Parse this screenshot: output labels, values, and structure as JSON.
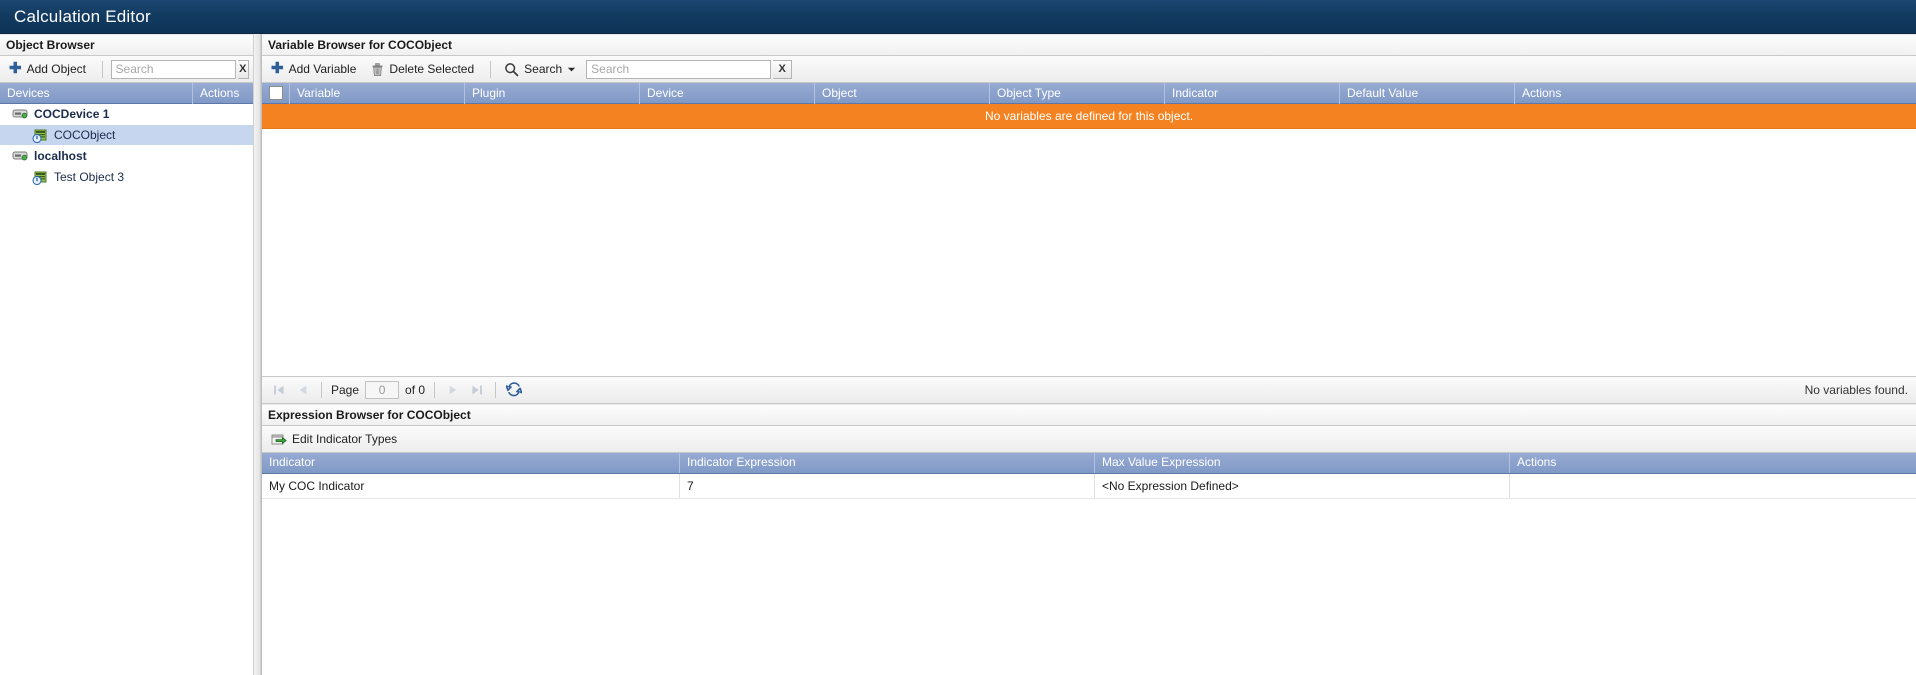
{
  "window": {
    "app_title": "Calculation Editor"
  },
  "object_browser": {
    "header": "Object Browser",
    "toolbar": {
      "add_object_label": "Add Object",
      "search_placeholder": "Search",
      "search_value": "",
      "clear_label": "X"
    },
    "columns": [
      "Devices",
      "Actions"
    ],
    "tree": [
      {
        "label": "COCDevice 1",
        "type": "device",
        "level": 1,
        "selected": false,
        "icon": "server-icon"
      },
      {
        "label": "COCObject",
        "type": "object",
        "level": 2,
        "selected": true,
        "icon": "chip-icon"
      },
      {
        "label": "localhost",
        "type": "device",
        "level": 1,
        "selected": false,
        "icon": "server-icon"
      },
      {
        "label": "Test Object 3",
        "type": "object",
        "level": 2,
        "selected": false,
        "icon": "chip-icon"
      }
    ]
  },
  "variable_browser": {
    "header": "Variable Browser for COCObject",
    "toolbar": {
      "add_variable_label": "Add Variable",
      "delete_selected_label": "Delete Selected",
      "search_menu_label": "Search",
      "search_placeholder": "Search",
      "search_value": "",
      "clear_label": "X"
    },
    "columns": [
      "Variable",
      "Plugin",
      "Device",
      "Object",
      "Object Type",
      "Indicator",
      "Default Value",
      "Actions"
    ],
    "rows": [],
    "empty_message": "No variables are defined for this object.",
    "pager": {
      "first_label": "⏮",
      "prev_label": "◀",
      "page_label": "Page",
      "page_value": "0",
      "of_label": "of 0",
      "next_label": "▶",
      "last_label": "⏭",
      "refresh_label": "refresh",
      "status": "No variables found."
    }
  },
  "expression_browser": {
    "header": "Expression Browser for COCObject",
    "toolbar": {
      "edit_indicator_types_label": "Edit Indicator Types"
    },
    "columns": [
      "Indicator",
      "Indicator Expression",
      "Max Value Expression",
      "Actions"
    ],
    "rows": [
      {
        "indicator": "My COC Indicator",
        "indicator_expression": "7",
        "max_value_expression": "<No Expression Defined>",
        "actions": ""
      }
    ]
  },
  "colors": {
    "titlebar": "#123a60",
    "grid_header": "#8099c6",
    "empty_banner": "#f58220",
    "selection": "#c7d6ef"
  }
}
